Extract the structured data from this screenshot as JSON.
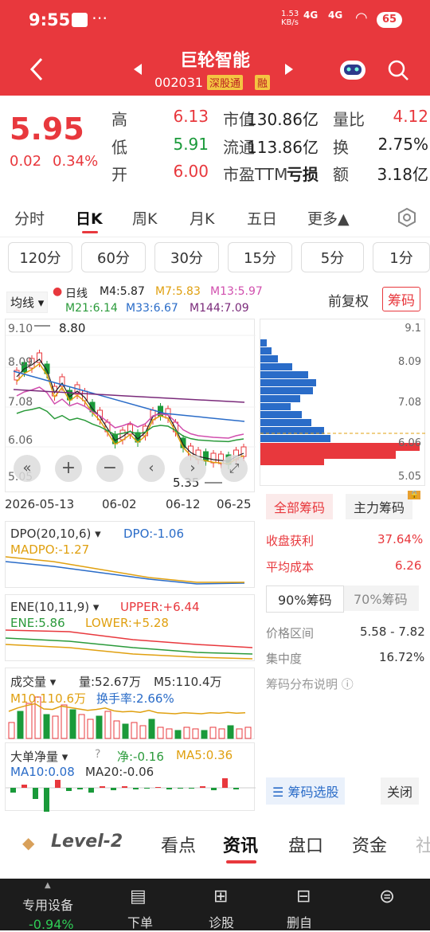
{
  "status": {
    "time": "9:55",
    "speed": "1.53\nKB/s",
    "net1": "4G",
    "net2": "4G",
    "battery": "65"
  },
  "header": {
    "name": "巨轮智能",
    "code": "002031",
    "badge1": "深股通",
    "badge2": "融"
  },
  "quote": {
    "price": "5.95",
    "change": "0.02",
    "change_pct": "0.34%",
    "rows": [
      {
        "l1": "高",
        "v1": "6.13",
        "l2": "市值",
        "v2": "130.86亿",
        "l3": "量比",
        "v3": "4.12"
      },
      {
        "l1": "低",
        "v1": "5.91",
        "l2": "流通",
        "v2": "113.86亿",
        "l3": "换",
        "v3": "2.75%"
      },
      {
        "l1": "开",
        "v1": "6.00",
        "l2": "市盈TTM",
        "v2": "亏损",
        "l3": "额",
        "v3": "3.18亿"
      }
    ]
  },
  "tabs": [
    "分时",
    "日K",
    "周K",
    "月K",
    "五日",
    "更多▲"
  ],
  "periods": [
    "120分",
    "60分",
    "30分",
    "15分",
    "5分",
    "1分"
  ],
  "ma": {
    "mode": "均线",
    "line": "日线",
    "m4": "M4:5.87",
    "m7": "M7:5.83",
    "m13": "M13:5.97",
    "m21": "M21:6.14",
    "m33": "M33:6.67",
    "m144": "M144:7.09",
    "fq": "前复权",
    "chip": "筹码"
  },
  "kline": {
    "y_labels": [
      "9.10",
      "8.09",
      "7.08",
      "6.06",
      "5.05"
    ],
    "high_mark": "8.80",
    "low_mark": "5.35",
    "dates": [
      "2026-05-13",
      "06-02",
      "06-12",
      "06-25"
    ]
  },
  "chip": {
    "y_labels": [
      "9.1",
      "8.09",
      "7.08",
      "6.06",
      "5.05"
    ],
    "tab_all": "全部筹码",
    "tab_main": "主力筹码",
    "profit_label": "收盘获利",
    "profit": "37.64%",
    "avg_label": "平均成本",
    "avg": "6.26",
    "tab90": "90%筹码",
    "tab70": "70%筹码",
    "range_label": "价格区间",
    "range": "5.58 - 7.82",
    "conc_label": "集中度",
    "conc": "16.72%",
    "desc": "筹码分布说明",
    "pick": "筹码选股",
    "close": "关闭"
  },
  "dpo": {
    "name": "DPO(20,10,6)",
    "dpo": "DPO:-1.06",
    "madpo": "MADPO:-1.27"
  },
  "ene": {
    "name": "ENE(10,11,9)",
    "upper": "UPPER:+6.44",
    "ene": "ENE:5.86",
    "lower": "LOWER:+5.28"
  },
  "vol": {
    "name": "成交量",
    "vol": "量:52.67万",
    "m5": "M5:110.4万",
    "m10": "M10:110.6万",
    "turn": "换手率:2.66%"
  },
  "big": {
    "name": "大单净量",
    "net": "净:-0.16",
    "ma5": "MA5:0.36",
    "ma10": "MA10:0.08",
    "ma20": "MA20:-0.06"
  },
  "bottom_tabs": [
    "Level-2",
    "看点",
    "资讯",
    "盘口",
    "资金",
    "社"
  ],
  "toolbar": {
    "device": "专用设备",
    "device_pct": "-0.94%",
    "order": "下单",
    "diag": "诊股",
    "del": "删自"
  }
}
